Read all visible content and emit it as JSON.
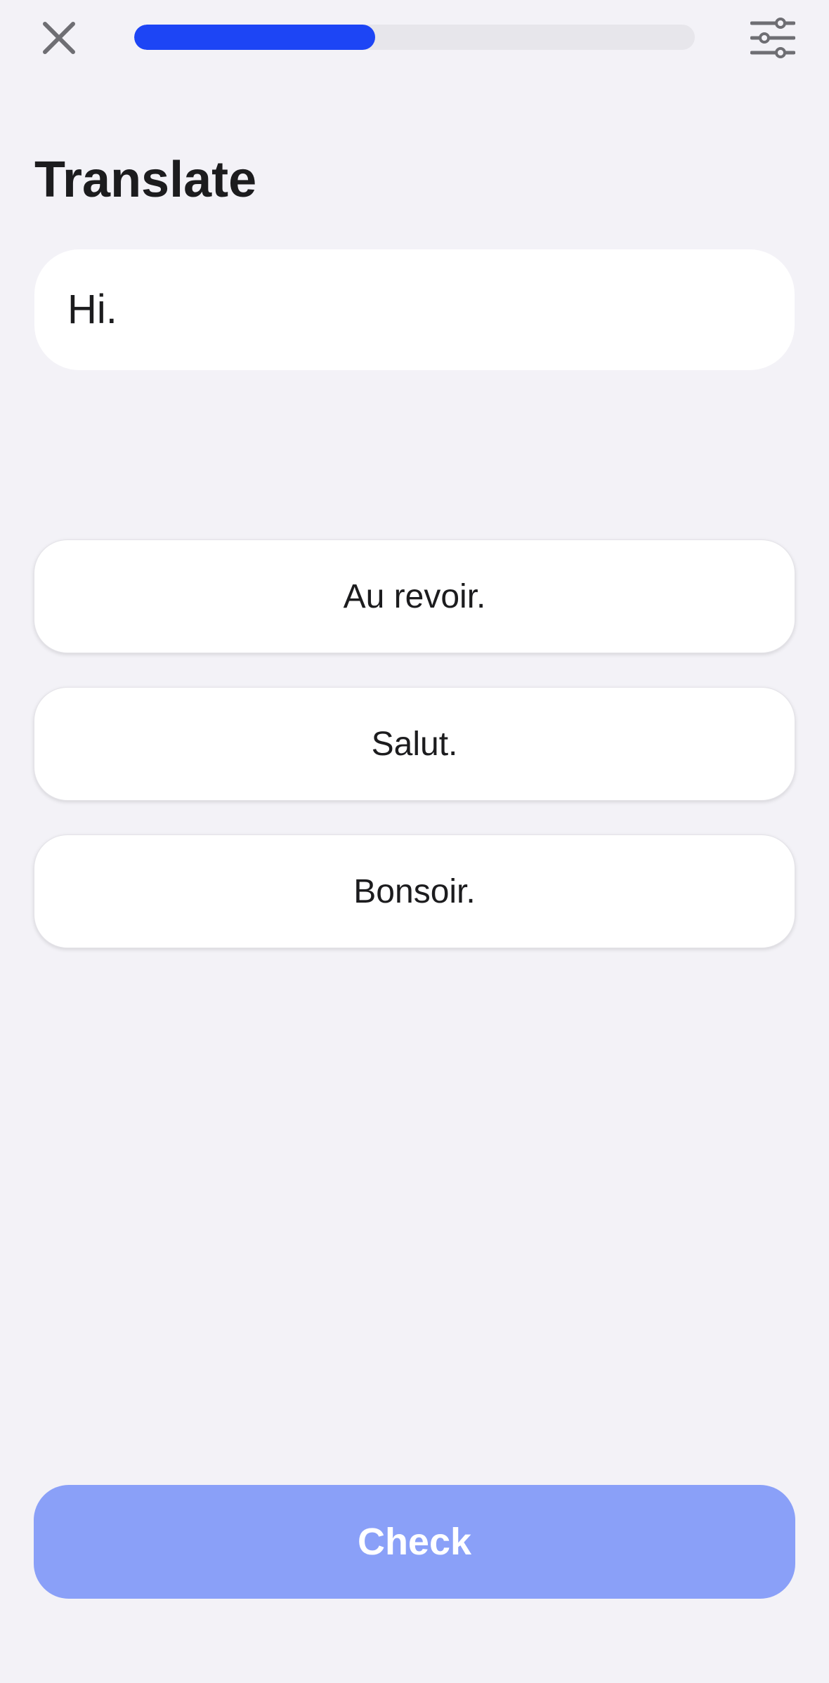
{
  "header": {
    "close_icon": "close-icon",
    "settings_icon": "sliders-icon",
    "progress": 0.43,
    "progress_color": "#1d45f5",
    "progress_track_color": "#e7e6eb"
  },
  "exercise": {
    "title": "Translate",
    "prompt": "Hi.",
    "options": [
      {
        "label": "Au revoir."
      },
      {
        "label": "Salut."
      },
      {
        "label": "Bonsoir."
      }
    ]
  },
  "footer": {
    "check_label": "Check",
    "check_color": "#8aa0f8"
  }
}
